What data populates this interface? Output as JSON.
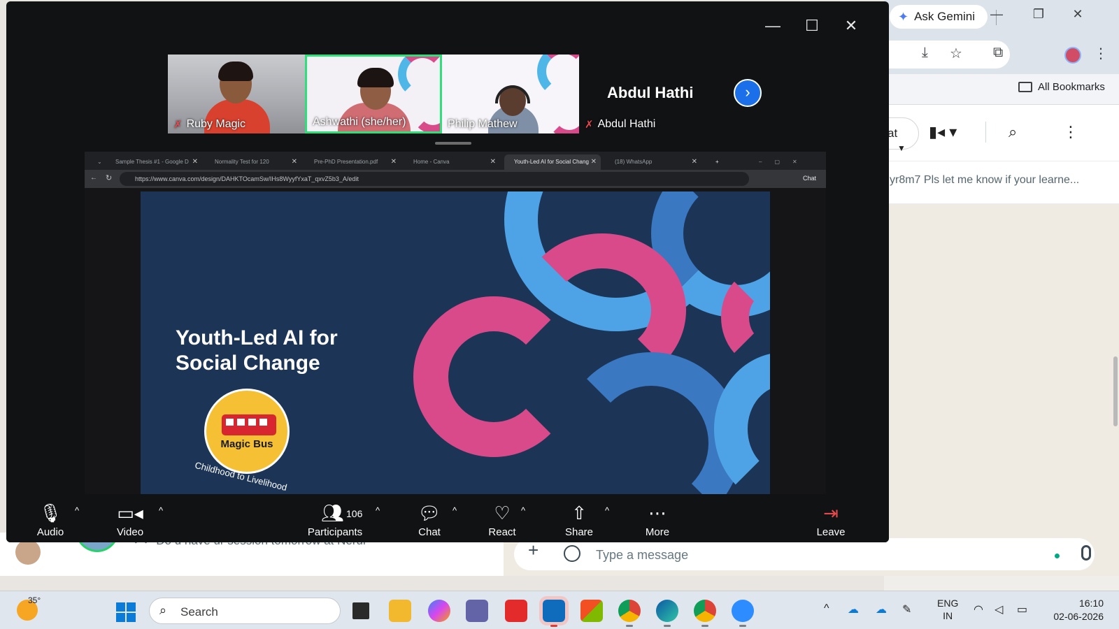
{
  "background_browser": {
    "gemini_label": "Ask Gemini",
    "bookmarks_label": "All Bookmarks"
  },
  "whatsapp": {
    "chat_pill": "at",
    "notice_text": "yr8m7 Pls let me know if your learne...",
    "last_message": "Do u have ur session tomorrow at Nerul",
    "compose_placeholder": "Type a message"
  },
  "zoom": {
    "participants": [
      {
        "name": "Ruby Magic",
        "muted": true
      },
      {
        "name": "Ashwathi (she/her)",
        "muted": false,
        "active_speaker": true
      },
      {
        "name": "Philip Mathew",
        "muted": false
      },
      {
        "name": "Abdul Hathi",
        "muted": true,
        "video_off": true
      }
    ],
    "shared_browser": {
      "tabs": [
        {
          "label": "Sample Thesis #1 - Google D"
        },
        {
          "label": "Normality Test for 120"
        },
        {
          "label": "Pre-PhD Presentation.pdf"
        },
        {
          "label": "Home - Canva"
        },
        {
          "label": "Youth-Led AI for Social Chang",
          "active": true
        },
        {
          "label": "(18) WhatsApp"
        }
      ],
      "url": "https://www.canva.com/design/DAHKTOcamSw/IHs8WyyfYxaT_qxvZ5b3_A/edit",
      "chat_label": "Chat"
    },
    "slide": {
      "title_line1": "Youth-Led AI for",
      "title_line2": "Social Change",
      "logo_text": "Magic Bus",
      "logo_tagline": "Childhood to Livelihood",
      "colors": {
        "background": "#1c3557",
        "light_blue": "#4ea3e6",
        "mid_blue": "#3a78c2",
        "pink": "#d94a8a"
      }
    },
    "toolbar": {
      "audio": "Audio",
      "video": "Video",
      "participants": "Participants",
      "participant_count": "106",
      "chat": "Chat",
      "react": "React",
      "share": "Share",
      "more": "More",
      "leave": "Leave"
    }
  },
  "taskbar": {
    "temperature": "35°",
    "search_placeholder": "Search",
    "language_top": "ENG",
    "language_bottom": "IN",
    "time": "16:10",
    "date": "02-06-2026"
  }
}
